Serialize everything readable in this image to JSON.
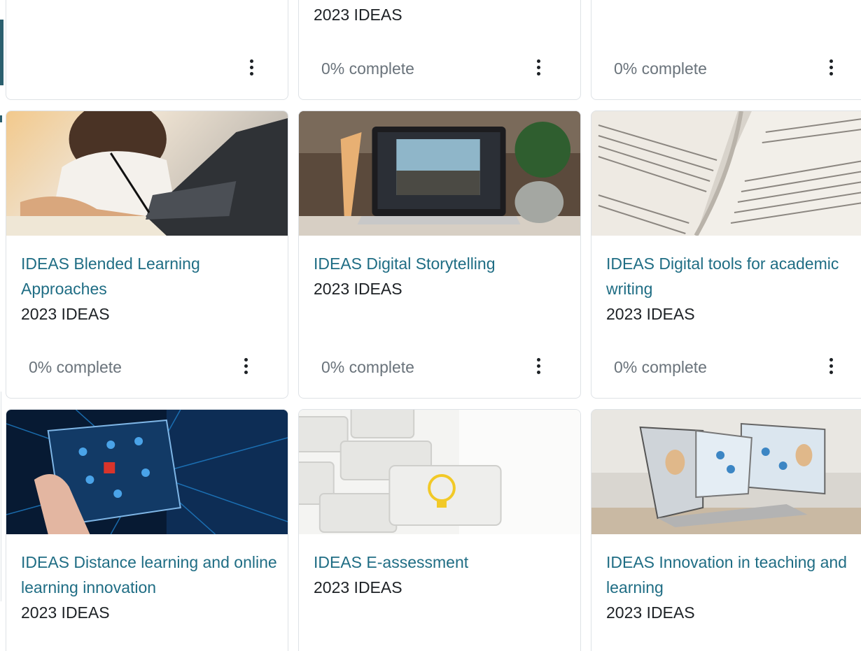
{
  "top_row": [
    {
      "category": "",
      "progress": "",
      "menu_icon": "kebab-menu-icon"
    },
    {
      "category": "2023 IDEAS",
      "progress": "0% complete",
      "menu_icon": "kebab-menu-icon"
    },
    {
      "category": "",
      "progress": "0% complete",
      "menu_icon": "kebab-menu-icon"
    }
  ],
  "courses": [
    {
      "title": "IDEAS Blended Learning Approaches",
      "category": "2023 IDEAS",
      "progress": "0% complete",
      "image": "person-writing-laptop-image"
    },
    {
      "title": "IDEAS Digital Storytelling",
      "category": "2023 IDEAS",
      "progress": "0% complete",
      "image": "laptop-photo-editing-image"
    },
    {
      "title": "IDEAS Digital tools for academic writing",
      "category": "2023 IDEAS",
      "progress": "0% complete",
      "image": "open-book-image"
    },
    {
      "title": "IDEAS Distance learning and online learning innovation",
      "category": "2023 IDEAS",
      "image": "digital-tablet-network-image"
    },
    {
      "title": "IDEAS E-assessment",
      "category": "2023 IDEAS",
      "image": "keyboard-lightbulb-key-image"
    },
    {
      "title": "IDEAS Innovation in teaching and learning",
      "category": "2023 IDEAS",
      "image": "laptop-video-conference-image"
    }
  ],
  "colors": {
    "link": "#1f6d84",
    "accent": "#2b5f6e",
    "muted": "#6a737b",
    "border": "#dee2e6"
  }
}
